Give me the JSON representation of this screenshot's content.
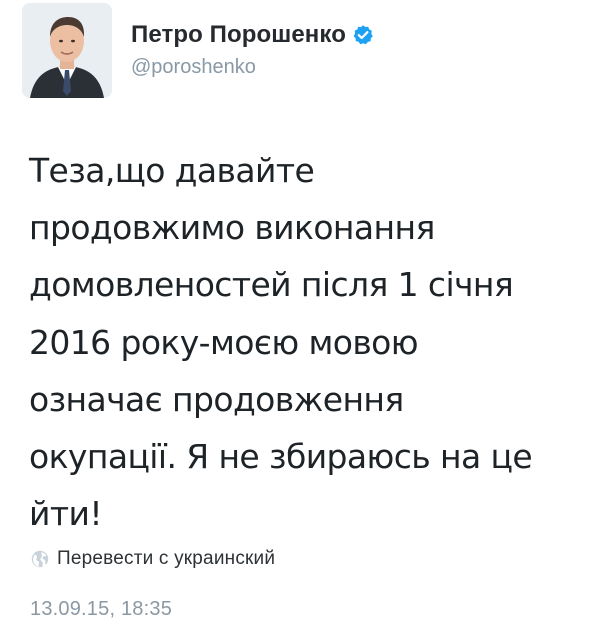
{
  "author": {
    "display_name": "Петро Порошенко",
    "handle": "@poroshenko",
    "verified": true,
    "avatar_icon": "profile-photo"
  },
  "tweet": {
    "lines": [
      "Теза,що давайте",
      "продовжимо виконання",
      "домовленостей після 1 січня",
      "2016 року-моєю мовою",
      "означає продовження",
      "окупації. Я не збираюсь на це",
      "йти!"
    ]
  },
  "translate": {
    "icon": "globe-icon",
    "label": "Перевести с украинский"
  },
  "timestamp": "13.09.15, 18:35",
  "colors": {
    "verified": "#1da1f2",
    "muted": "#8899a6",
    "text": "#1d2327"
  }
}
